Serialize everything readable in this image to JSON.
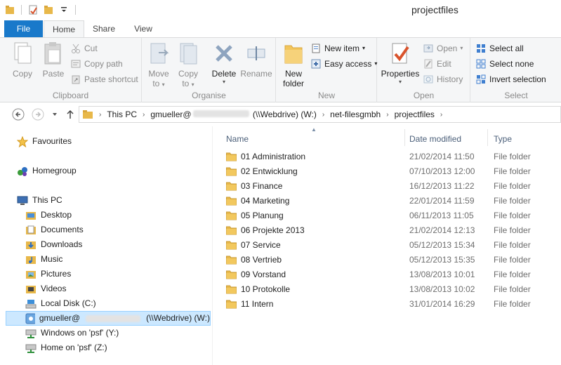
{
  "window": {
    "title": "projectfiles"
  },
  "tabs": {
    "file": "File",
    "home": "Home",
    "share": "Share",
    "view": "View"
  },
  "ribbon": {
    "clipboard": {
      "label": "Clipboard",
      "copy": "Copy",
      "paste": "Paste",
      "cut": "Cut",
      "copy_path": "Copy path",
      "paste_shortcut": "Paste shortcut"
    },
    "organise": {
      "label": "Organise",
      "move_to": "Move",
      "move_to_2": "to",
      "copy_to": "Copy",
      "copy_to_2": "to",
      "delete": "Delete",
      "rename": "Rename"
    },
    "new": {
      "label": "New",
      "new_folder": "New",
      "new_folder_2": "folder",
      "new_item": "New item",
      "easy_access": "Easy access"
    },
    "open": {
      "label": "Open",
      "properties": "Properties",
      "open": "Open",
      "edit": "Edit",
      "history": "History"
    },
    "select": {
      "label": "Select",
      "select_all": "Select all",
      "select_none": "Select none",
      "invert_selection": "Invert selection"
    }
  },
  "address": {
    "crumbs": [
      "This PC",
      "gmueller@",
      "(\\\\Webdrive) (W:)",
      "net-filesgmbh",
      "projectfiles"
    ]
  },
  "navpane": {
    "favourites": "Favourites",
    "homegroup": "Homegroup",
    "this_pc": "This PC",
    "items": [
      "Desktop",
      "Documents",
      "Downloads",
      "Music",
      "Pictures",
      "Videos",
      "Local Disk (C:)"
    ],
    "webdrive_prefix": "gmueller@",
    "webdrive_suffix": "(\\\\Webdrive) (W:)",
    "windows_psf": "Windows on 'psf' (Y:)",
    "home_psf": "Home on 'psf' (Z:)"
  },
  "columns": {
    "name": "Name",
    "date": "Date modified",
    "type": "Type"
  },
  "files": [
    {
      "name": "01 Administration",
      "date": "21/02/2014 11:50",
      "type": "File folder"
    },
    {
      "name": "02 Entwicklung",
      "date": "07/10/2013 12:00",
      "type": "File folder"
    },
    {
      "name": "03 Finance",
      "date": "16/12/2013 11:22",
      "type": "File folder"
    },
    {
      "name": "04 Marketing",
      "date": "22/01/2014 11:59",
      "type": "File folder"
    },
    {
      "name": "05 Planung",
      "date": "06/11/2013 11:05",
      "type": "File folder"
    },
    {
      "name": "06 Projekte 2013",
      "date": "21/02/2014 12:13",
      "type": "File folder"
    },
    {
      "name": "07 Service",
      "date": "05/12/2013 15:34",
      "type": "File folder"
    },
    {
      "name": "08 Vertrieb",
      "date": "05/12/2013 15:35",
      "type": "File folder"
    },
    {
      "name": "09 Vorstand",
      "date": "13/08/2013 10:01",
      "type": "File folder"
    },
    {
      "name": "10 Protokolle",
      "date": "13/08/2013 10:02",
      "type": "File folder"
    },
    {
      "name": "11 Intern",
      "date": "31/01/2014 16:29",
      "type": "File folder"
    }
  ]
}
